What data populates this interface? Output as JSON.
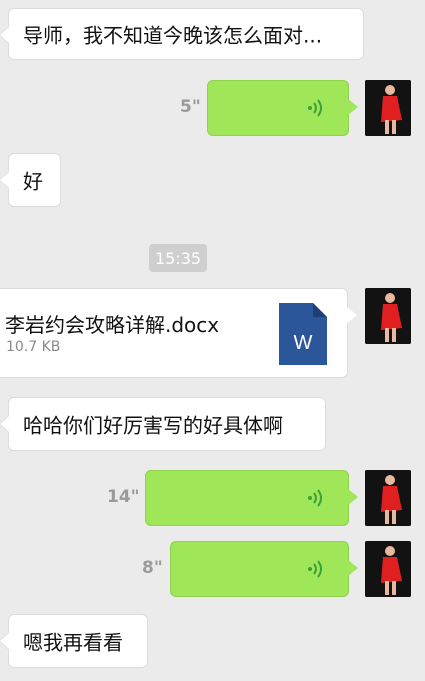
{
  "messages": [
    {
      "type": "text",
      "side": "left",
      "text": "导师，我不知道今晚该怎么面对..."
    },
    {
      "type": "voice",
      "side": "right",
      "duration": "5\""
    },
    {
      "type": "text",
      "side": "left",
      "text": "好"
    },
    {
      "type": "timestamp",
      "text": "15:35"
    },
    {
      "type": "file",
      "side": "right",
      "file_name": "李岩约会攻略详解.docx",
      "file_size": "10.7 KB",
      "icon_letter": "W"
    },
    {
      "type": "text",
      "side": "left",
      "text": "哈哈你们好厉害写的好具体啊"
    },
    {
      "type": "voice",
      "side": "right",
      "duration": "14\""
    },
    {
      "type": "voice",
      "side": "right",
      "duration": "8\""
    },
    {
      "type": "text",
      "side": "left",
      "text": "嗯我再看看"
    }
  ],
  "colors": {
    "background": "#ebebeb",
    "voice_bubble": "#9fe658",
    "voice_wave": "#3aa03a",
    "word_icon": "#2b579a",
    "avatar_dress": "#e02020"
  },
  "icons": {
    "voice": "voice-wave-icon",
    "file": "word-doc-icon",
    "avatar": "user-avatar"
  }
}
